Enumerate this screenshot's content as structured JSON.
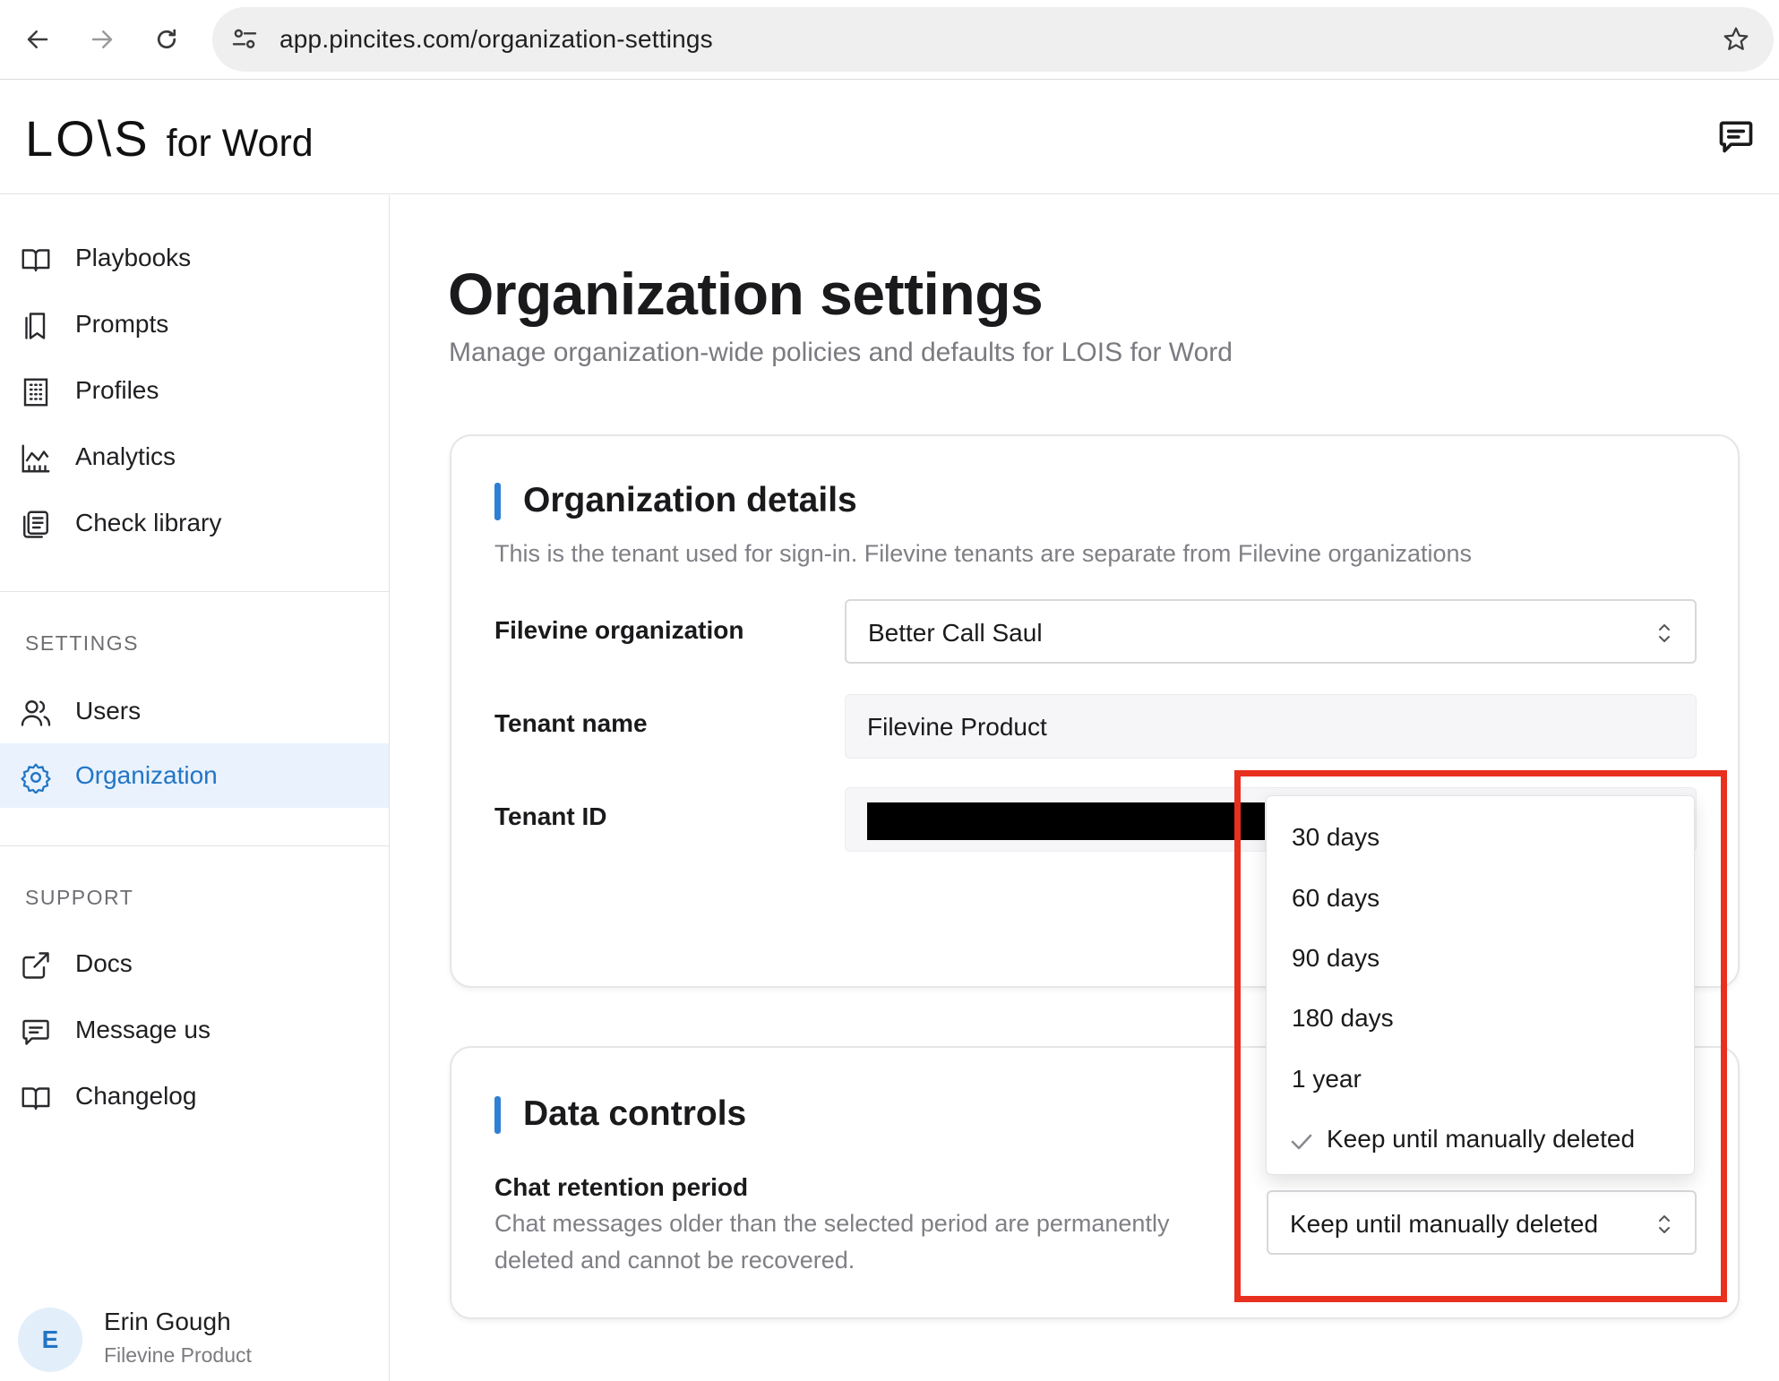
{
  "browser": {
    "url": "app.pincites.com/organization-settings"
  },
  "app": {
    "brand": "LO\\S",
    "brand_suffix": "for Word"
  },
  "sidebar": {
    "main_items": [
      {
        "label": "Playbooks",
        "icon": "book-open-icon"
      },
      {
        "label": "Prompts",
        "icon": "bookmark-icon"
      },
      {
        "label": "Profiles",
        "icon": "building-icon"
      },
      {
        "label": "Analytics",
        "icon": "chart-icon"
      },
      {
        "label": "Check library",
        "icon": "library-icon"
      }
    ],
    "settings_heading": "SETTINGS",
    "settings_items": [
      {
        "label": "Users",
        "icon": "users-icon"
      },
      {
        "label": "Organization",
        "icon": "gear-icon",
        "active": true
      }
    ],
    "support_heading": "SUPPORT",
    "support_items": [
      {
        "label": "Docs",
        "icon": "external-link-icon"
      },
      {
        "label": "Message us",
        "icon": "message-icon"
      },
      {
        "label": "Changelog",
        "icon": "book-open-icon"
      }
    ],
    "user": {
      "initial": "E",
      "name": "Erin Gough",
      "org": "Filevine Product"
    }
  },
  "main": {
    "title": "Organization settings",
    "subtitle": "Manage organization-wide policies and defaults for LOIS for Word",
    "org_details": {
      "title": "Organization details",
      "description": "This is the tenant used for sign-in. Filevine tenants are separate from Filevine organizations",
      "fields": {
        "filevine_org_label": "Filevine organization",
        "filevine_org_value": "Better Call Saul",
        "tenant_name_label": "Tenant name",
        "tenant_name_value": "Filevine Product",
        "tenant_id_label": "Tenant ID"
      }
    },
    "data_controls": {
      "title": "Data controls",
      "retention_label": "Chat retention period",
      "retention_description": "Chat messages older than the selected period are permanently deleted and cannot be recovered.",
      "retention_value": "Keep until manually deleted",
      "options": [
        "30 days",
        "60 days",
        "90 days",
        "180 days",
        "1 year",
        "Keep until manually deleted"
      ],
      "selected_option": "Keep until manually deleted"
    }
  },
  "colors": {
    "accent": "#2275c4",
    "active_bg": "#e9f2fd",
    "card_bar": "#2f7fd3",
    "highlight": "#e8301f"
  }
}
